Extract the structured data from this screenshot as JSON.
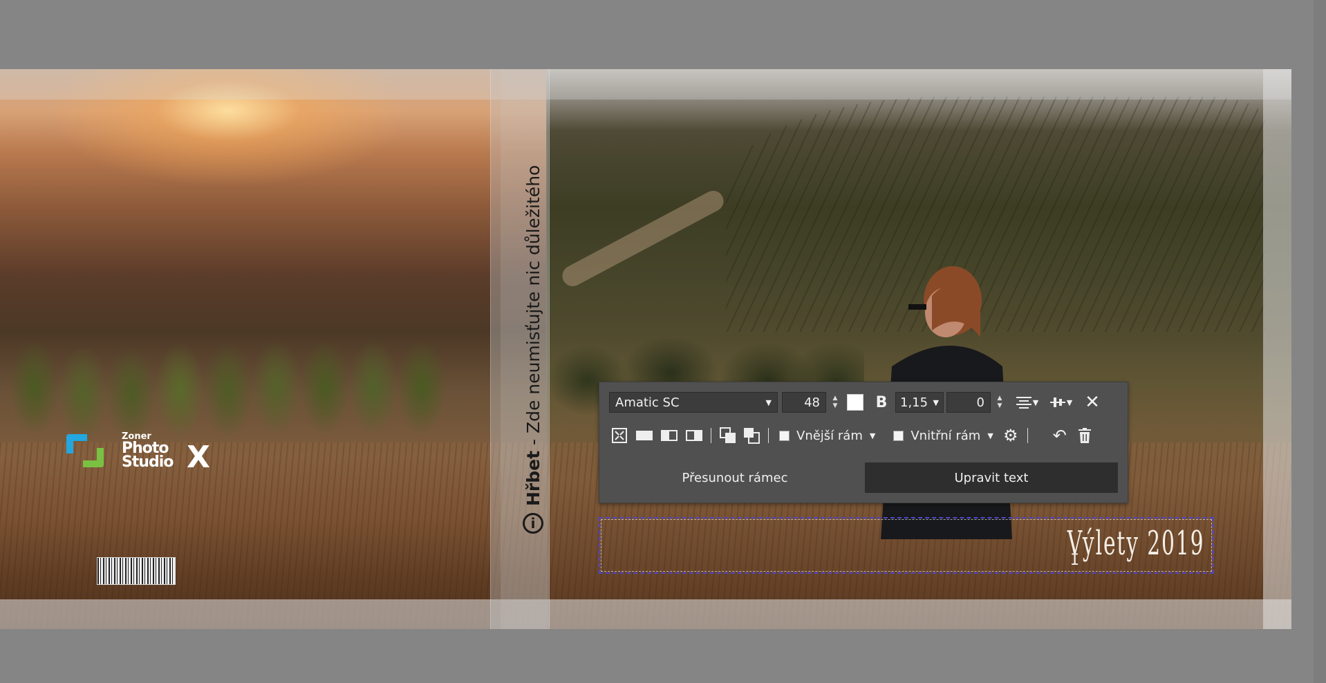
{
  "spine": {
    "title_bold": "Hřbet",
    "title_rest": " - Zde neumisťujte nic důležitého"
  },
  "logo": {
    "brand_small": "Zoner",
    "line1": "Photo",
    "line2": "Studio",
    "suffix": "X"
  },
  "text_frame": {
    "content": "Výlety 2019"
  },
  "toolbar": {
    "font_family": "Amatic SC",
    "font_size": "48",
    "bold_label": "B",
    "line_height": "1,15",
    "letter_spacing": "0",
    "outer_frame_label": "Vnější rám",
    "inner_frame_label": "Vnitřní rám",
    "move_frame_label": "Přesunout rámec",
    "edit_text_label": "Upravit text",
    "text_color": "#ffffff",
    "outer_frame_checked": false,
    "inner_frame_checked": false,
    "active_mode": "edit_text"
  },
  "icons": {
    "dropdown": "chevron-down-icon",
    "spinner": "spin-arrows-icon",
    "align": "align-center-icon",
    "valign": "vertical-align-icon",
    "close": "close-icon",
    "fit": "fit-frame-icon",
    "fill": "fill-frame-icon",
    "align_left": "image-left-icon",
    "align_right": "image-right-icon",
    "bring_front": "bring-to-front-icon",
    "send_back": "send-to-back-icon",
    "settings": "gear-icon",
    "undo": "undo-icon",
    "delete": "trash-icon"
  }
}
